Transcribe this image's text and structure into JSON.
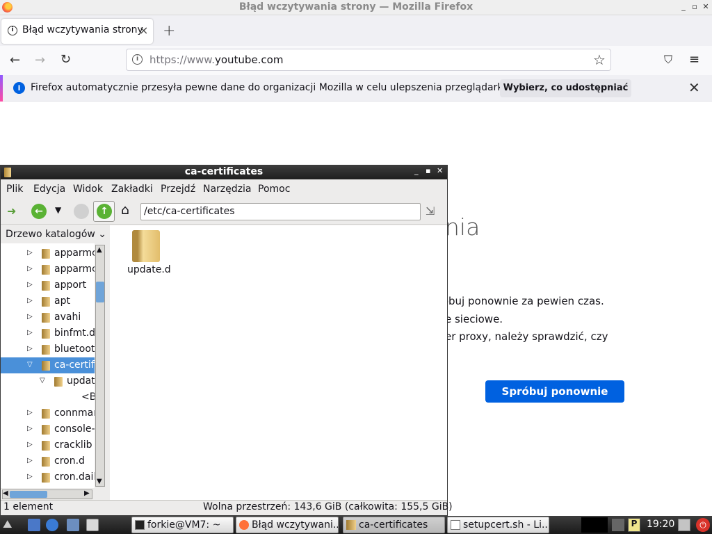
{
  "firefox": {
    "window_title": "Błąd wczytywania strony — Mozilla Firefox",
    "tab_title": "Błąd wczytywania strony",
    "tab_close": "×",
    "new_tab": "+",
    "url_prefix": "https://www.",
    "url_domain": "youtube.com",
    "notification": {
      "text": "Firefox automatycznie przesyła pewne dane do organizacji Mozilla w celu ulepszenia przeglądarki.",
      "button": "Wybierz, co udostępniać"
    },
    "error_page": {
      "title_fragment": "nia",
      "lines": [
        "róbuj ponownie za pewien czas.",
        "e sieciowe.",
        "er proxy, należy sprawdzić, czy"
      ],
      "retry_button": "Spróbuj ponownie"
    }
  },
  "file_manager": {
    "window_title": "ca-certificates",
    "menu": [
      "Plik",
      "Edycja",
      "Widok",
      "Zakładki",
      "Przejdź",
      "Narzędzia",
      "Pomoc"
    ],
    "path": "/etc/ca-certificates",
    "side_header": "Drzewo katalogów",
    "tree": [
      {
        "label": "apparmc",
        "level": 0,
        "expanded": false,
        "selected": false
      },
      {
        "label": "apparmc",
        "level": 0,
        "expanded": false,
        "selected": false
      },
      {
        "label": "apport",
        "level": 0,
        "expanded": false,
        "selected": false
      },
      {
        "label": "apt",
        "level": 0,
        "expanded": false,
        "selected": false
      },
      {
        "label": "avahi",
        "level": 0,
        "expanded": false,
        "selected": false
      },
      {
        "label": "binfmt.d",
        "level": 0,
        "expanded": false,
        "selected": false
      },
      {
        "label": "bluetoot",
        "level": 0,
        "expanded": false,
        "selected": false
      },
      {
        "label": "ca-certifi",
        "level": 0,
        "expanded": true,
        "selected": true
      },
      {
        "label": "updat",
        "level": 1,
        "expanded": true,
        "selected": false
      },
      {
        "label": "<B",
        "level": 2,
        "expanded": null,
        "selected": false
      },
      {
        "label": "connmar",
        "level": 0,
        "expanded": false,
        "selected": false
      },
      {
        "label": "console-",
        "level": 0,
        "expanded": false,
        "selected": false
      },
      {
        "label": "cracklib",
        "level": 0,
        "expanded": false,
        "selected": false
      },
      {
        "label": "cron.d",
        "level": 0,
        "expanded": false,
        "selected": false
      },
      {
        "label": "cron.dail",
        "level": 0,
        "expanded": false,
        "selected": false
      }
    ],
    "files": [
      {
        "name": "update.d",
        "icon": "folder-icon"
      }
    ],
    "status_left": "1 element",
    "status_right": "Wolna przestrzeń: 143,6 GiB (całkowita: 155,5 GiB)"
  },
  "taskbar": {
    "tasks": [
      {
        "label": "forkie@VM7: ~",
        "icon": "terminal-icon",
        "active": false
      },
      {
        "label": "Błąd wczytywani...",
        "icon": "firefox-icon",
        "active": false
      },
      {
        "label": "ca-certificates",
        "icon": "folder-icon",
        "active": true
      },
      {
        "label": "setupcert.sh - Li...",
        "icon": "text-file-icon",
        "active": false
      }
    ],
    "clock": "19:20"
  }
}
